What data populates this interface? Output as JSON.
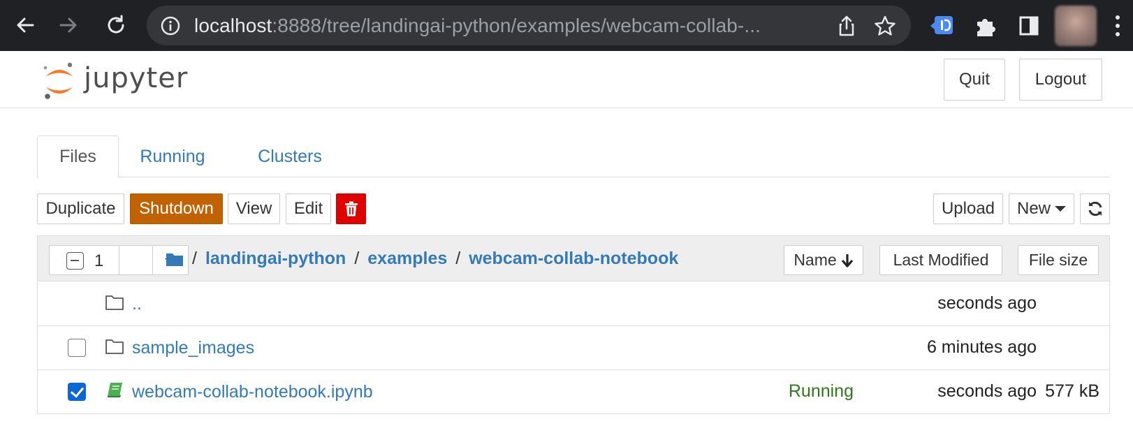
{
  "browser": {
    "url_host": "localhost",
    "url_rest": ":8888/tree/landingai-python/examples/webcam-collab-..."
  },
  "header": {
    "logo_text": "jupyter",
    "quit_label": "Quit",
    "logout_label": "Logout"
  },
  "tabs": [
    {
      "label": "Files",
      "active": true
    },
    {
      "label": "Running",
      "active": false
    },
    {
      "label": "Clusters",
      "active": false
    }
  ],
  "toolbar": {
    "duplicate_label": "Duplicate",
    "shutdown_label": "Shutdown",
    "view_label": "View",
    "edit_label": "Edit",
    "upload_label": "Upload",
    "new_label": "New"
  },
  "list_header": {
    "selected_count": "1",
    "breadcrumb_sep": "/",
    "breadcrumb": [
      "landingai-python",
      "examples",
      "webcam-collab-notebook"
    ],
    "sort_name_label": "Name",
    "sort_modified_label": "Last Modified",
    "sort_size_label": "File size"
  },
  "rows": [
    {
      "name": "..",
      "type": "folder",
      "checkbox": false,
      "status": "",
      "modified": "seconds ago",
      "size": ""
    },
    {
      "name": "sample_images",
      "type": "folder",
      "checkbox": true,
      "checked": false,
      "status": "",
      "modified": "6 minutes ago",
      "size": ""
    },
    {
      "name": "webcam-collab-notebook.ipynb",
      "type": "notebook",
      "checkbox": true,
      "checked": true,
      "status": "Running",
      "modified": "seconds ago",
      "size": "577 kB"
    }
  ],
  "colors": {
    "chrome_bg": "#202124",
    "link": "#337ab7",
    "shutdown": "#c06200",
    "delete": "#e00000",
    "running": "#2c7a1a",
    "checkbox_checked": "#0b67d6",
    "logo_orange": "#f37726"
  },
  "icons": {
    "back": "arrow-left-icon",
    "forward": "arrow-right-icon",
    "reload": "reload-icon",
    "info": "info-icon",
    "share": "share-icon",
    "bookmark": "star-icon",
    "extension_1": "translate-extension-icon",
    "extensions": "puzzle-icon",
    "sidepanel": "side-panel-icon",
    "delete": "trash-icon",
    "refresh": "refresh-icon",
    "folder": "folder-icon",
    "notebook": "notebook-icon"
  }
}
